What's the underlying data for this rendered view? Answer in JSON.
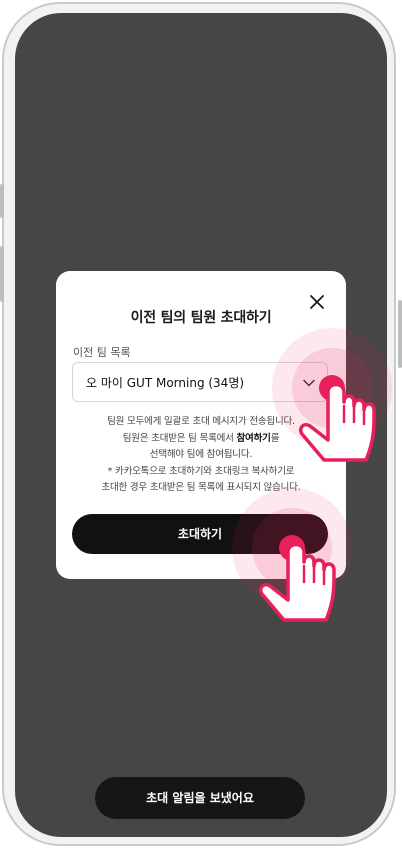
{
  "modal": {
    "title": "이전 팀의 팀원 초대하기",
    "list_label": "이전 팀 목록",
    "selected_team": "오 마이 GUT Morning (34명)",
    "desc_line1": "팀원 모두에게 일괄로 초대 메시지가 전송됩니다.",
    "desc_line2_a": "팀원은 초대받은 팀 목록에서 ",
    "desc_line2_b": "참여하기",
    "desc_line2_c": "를",
    "desc_line3": "선택해야 팀에 참여됩니다.",
    "desc_line4": "* 카카오톡으로 초대하기와 초대링크 복사하기로",
    "desc_line5": "초대한 경우 초대받은 팀 목록에 표시되지 않습니다.",
    "invite_button": "초대하기"
  },
  "toast": {
    "text": "초대 알림을 보냈어요"
  },
  "colors": {
    "overlay": "#464646",
    "primary": "#111111",
    "accent": "#e8205a"
  },
  "icons": [
    "close-icon",
    "chevron-down-icon",
    "tap-hand-icon"
  ]
}
